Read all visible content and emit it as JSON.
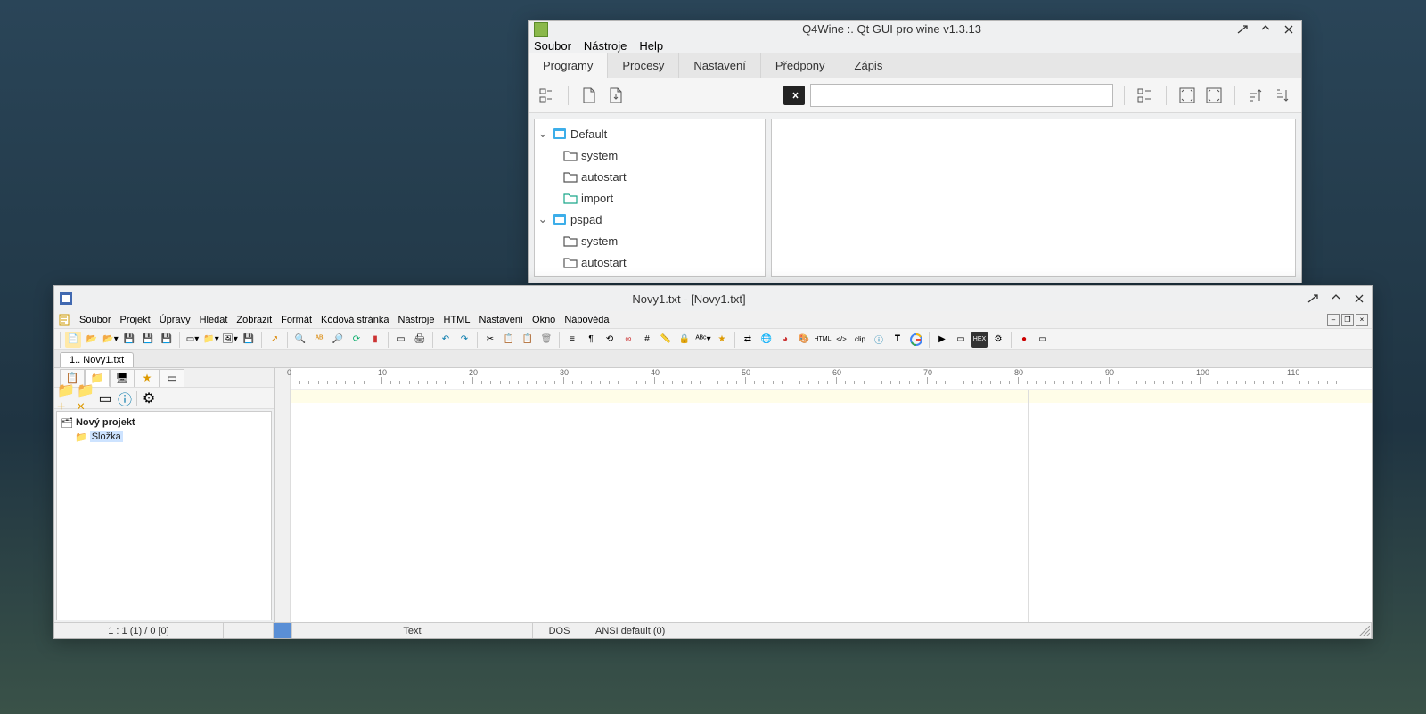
{
  "q4wine": {
    "title": "Q4Wine :. Qt GUI pro wine v1.3.13",
    "menu": [
      "Soubor",
      "Nástroje",
      "Help"
    ],
    "tabs": [
      "Programy",
      "Procesy",
      "Nastavení",
      "Předpony",
      "Zápis"
    ],
    "active_tab": 0,
    "tree": [
      {
        "name": "Default",
        "children": [
          "system",
          "autostart",
          "import"
        ]
      },
      {
        "name": "pspad",
        "children": [
          "system",
          "autostart"
        ]
      }
    ]
  },
  "pspad": {
    "title": "Novy1.txt - [Novy1.txt]",
    "menu": [
      "Soubor",
      "Projekt",
      "Úpravy",
      "Hledat",
      "Zobrazit",
      "Formát",
      "Kódová stránka",
      "Nástroje",
      "HTML",
      "Nastavení",
      "Okno",
      "Nápověda"
    ],
    "menu_ul": [
      "S",
      "P",
      "Ú",
      "H",
      "Z",
      "F",
      "K",
      "N",
      "H",
      "N",
      "O",
      "N"
    ],
    "file_tab": "1.. Novy1.txt",
    "project": {
      "root": "Nový projekt",
      "child": "Složka"
    },
    "ruler_marks": [
      0,
      10,
      20,
      30,
      40,
      50,
      60,
      70,
      80,
      90,
      100,
      110
    ],
    "status": {
      "pos": "1 : 1 (1) / 0  [0]",
      "mode": "Text",
      "eol": "DOS",
      "enc": "ANSI default (0)"
    }
  }
}
